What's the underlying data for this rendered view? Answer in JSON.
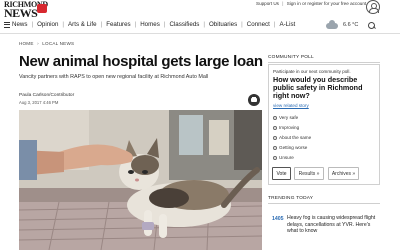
{
  "logo": {
    "line1": "RICHMOND",
    "line2": "NEWS"
  },
  "toplinks": {
    "support": "Support Us",
    "signin": "Sign in or register for your free account"
  },
  "nav": {
    "news": "News",
    "items": [
      "Opinion",
      "Arts & Life",
      "Features",
      "Homes",
      "Classifieds",
      "Obituaries",
      "Connect",
      "A-List"
    ]
  },
  "weather": {
    "temp": "6.6 °C"
  },
  "breadcrumb": {
    "home": "HOME",
    "section": "LOCAL NEWS"
  },
  "article": {
    "headline": "New animal hospital gets large loan",
    "subhead": "Vancity partners with RAPS to open new regional facility at Richmond Auto Mall",
    "author": "Paula Carlson/Contributor",
    "date": "Aug 3, 2017 4:46 PM"
  },
  "poll": {
    "header": "COMMUNITY POLL",
    "intro": "Participate in our next community poll.",
    "question": "How would you describe public safety in Richmond right now?",
    "related": "view related story",
    "options": [
      "Very safe",
      "Improving",
      "About the same",
      "Getting worse",
      "Unsure"
    ],
    "vote": "Vote",
    "results": "Results »",
    "archives": "Archives »"
  },
  "trending": {
    "header": "TRENDING TODAY",
    "items": [
      {
        "number": "1405",
        "text": "Heavy fog is causing widespread flight delays, cancellations at YVR. Here's what to know"
      }
    ]
  },
  "colors": {
    "brand_red": "#d7282f",
    "link_blue": "#2a6bb3"
  }
}
